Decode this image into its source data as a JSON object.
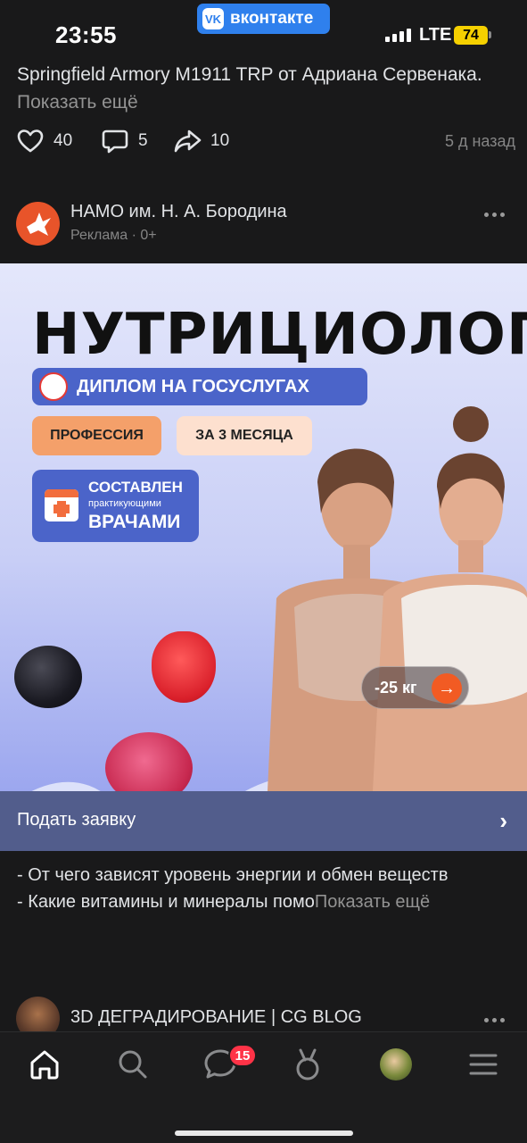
{
  "status_bar": {
    "time": "23:55",
    "app_pill": "вконтакте",
    "network": "LTE",
    "battery": "74"
  },
  "previous_post": {
    "text": "Springfield Armory M1911 TRP от Адриана Сервенака.",
    "more": "Показать ещё",
    "likes": "40",
    "comments": "5",
    "shares": "10",
    "time": "5 д назад"
  },
  "ad_post": {
    "author": "НАМО им. Н. А. Бородина",
    "meta": "Реклама · 0+",
    "banner": {
      "title": "НУТРИЦИОЛОГ",
      "diploma": "ДИПЛОМ НА ГОСУСЛУГАХ",
      "tag_profession": "ПРОФЕССИЯ",
      "tag_duration": "ЗА 3 МЕСЯЦА",
      "doctors_line1": "СОСТАВЛЕН",
      "doctors_line2": "практикующими",
      "doctors_line3": "ВРАЧАМИ",
      "weight_badge": "-25 кг"
    },
    "cta": "Подать заявку",
    "body_line1": "- От чего зависят уровень энергии и обмен веществ",
    "body_line2": "- Какие витамины и минералы помо",
    "body_more": "Показать ещё"
  },
  "next_post": {
    "author": "3D ДЕГРАДИРОВАНИЕ | CG BLOG"
  },
  "tabbar": {
    "messages_badge": "15"
  },
  "colors": {
    "background": "#19191a",
    "vk_blue": "#2f80ed",
    "cta_bg": "#525d8c",
    "badge_red": "#ff3347",
    "accent_orange": "#f25b23"
  }
}
